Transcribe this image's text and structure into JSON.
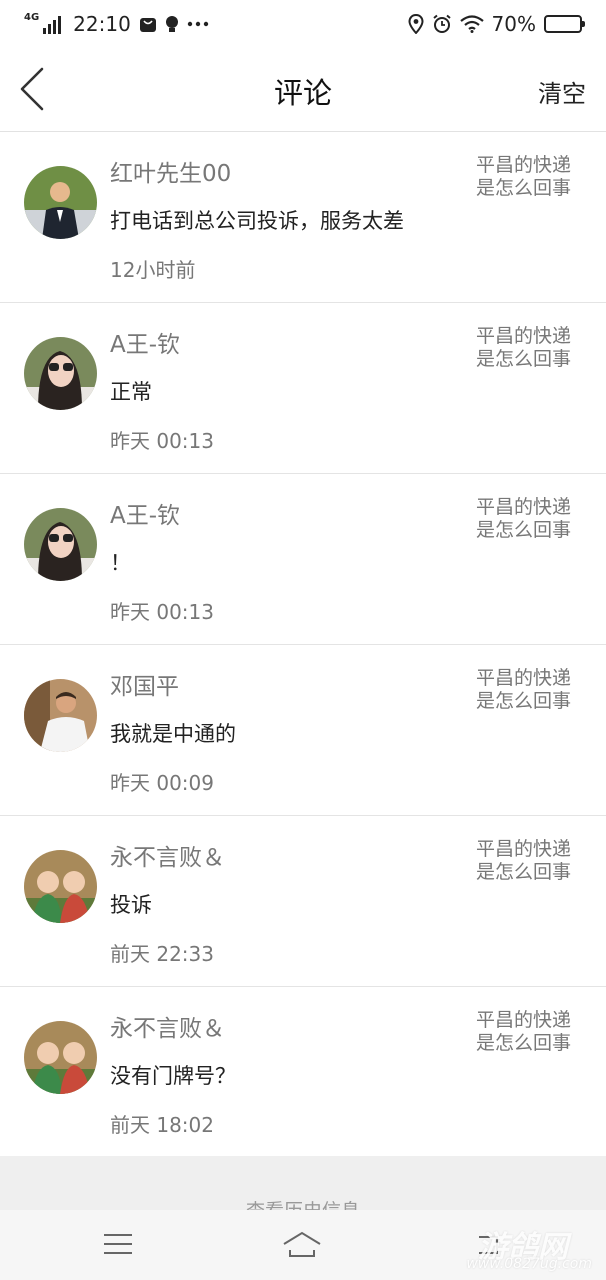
{
  "status_bar": {
    "network": "4G",
    "time": "22:10",
    "battery_text": "70%",
    "battery_level": 0.7
  },
  "header": {
    "title": "评论",
    "clear_label": "清空"
  },
  "comments": [
    {
      "name": "红叶先生00",
      "content": "打电话到总公司投诉，服务太差",
      "time": "12小时前",
      "post_line1": "平昌的快递",
      "post_line2": "是怎么回事"
    },
    {
      "name": "A王-钦",
      "content": "正常",
      "time": "昨天 00:13",
      "post_line1": "平昌的快递",
      "post_line2": "是怎么回事"
    },
    {
      "name": "A王-钦",
      "content": "！",
      "time": "昨天 00:13",
      "post_line1": "平昌的快递",
      "post_line2": "是怎么回事"
    },
    {
      "name": "邓国平",
      "content": "我就是中通的",
      "time": "昨天 00:09",
      "post_line1": "平昌的快递",
      "post_line2": "是怎么回事"
    },
    {
      "name": "永不言败＆",
      "content": "投诉",
      "time": "前天 22:33",
      "post_line1": "平昌的快递",
      "post_line2": "是怎么回事"
    },
    {
      "name": "永不言败＆",
      "content": "没有门牌号？",
      "time": "前天 18:02",
      "post_line1": "平昌的快递",
      "post_line2": "是怎么回事"
    }
  ],
  "footer": {
    "history_label": "查看历史信息"
  },
  "watermark": {
    "text": "游鸽网",
    "url": "www.0827ug.com"
  },
  "icons": {
    "back": "chevron-left-icon",
    "menu": "menu-icon",
    "home": "home-icon",
    "nav_back": "back-icon"
  }
}
